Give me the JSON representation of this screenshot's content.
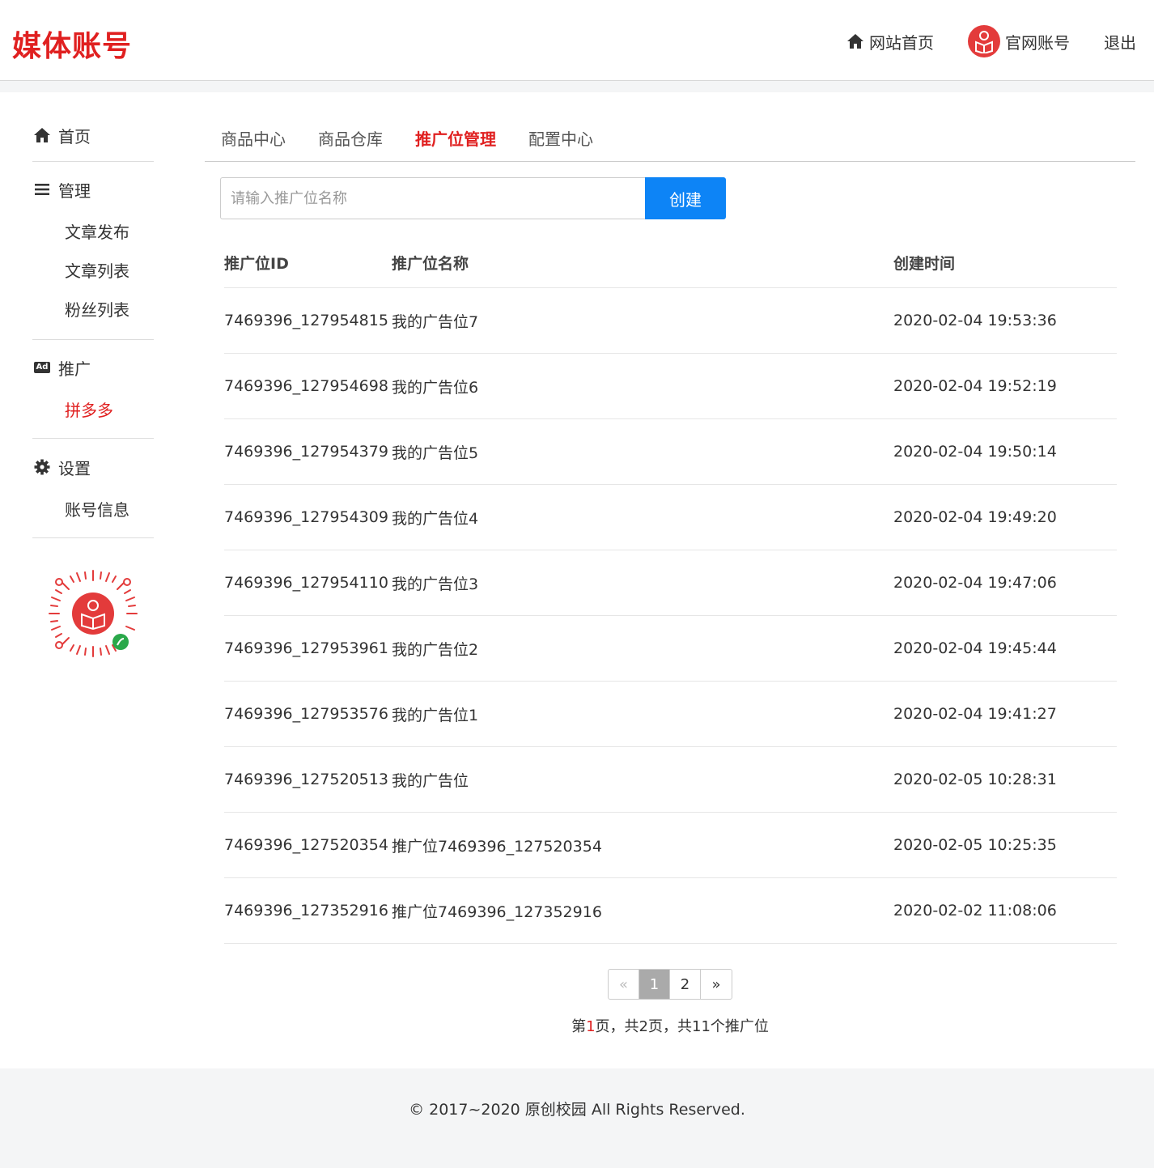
{
  "header": {
    "brand": "媒体账号",
    "nav": {
      "home_label": "网站首页",
      "account_label": "官网账号",
      "logout_label": "退出"
    }
  },
  "sidebar": {
    "home": "首页",
    "manage": {
      "title": "管理",
      "items": [
        "文章发布",
        "文章列表",
        "粉丝列表"
      ]
    },
    "promote": {
      "title": "推广",
      "badge": "Ad",
      "items": [
        "拼多多"
      ]
    },
    "settings": {
      "title": "设置",
      "items": [
        "账号信息"
      ]
    }
  },
  "tabs": [
    "商品中心",
    "商品仓库",
    "推广位管理",
    "配置中心"
  ],
  "active_tab": 2,
  "search": {
    "placeholder": "请输入推广位名称",
    "value": "",
    "button_label": "创建"
  },
  "table": {
    "headers": [
      "推广位ID",
      "推广位名称",
      "创建时间"
    ],
    "rows": [
      [
        "7469396_127954815",
        "我的广告位7",
        "2020-02-04 19:53:36"
      ],
      [
        "7469396_127954698",
        "我的广告位6",
        "2020-02-04 19:52:19"
      ],
      [
        "7469396_127954379",
        "我的广告位5",
        "2020-02-04 19:50:14"
      ],
      [
        "7469396_127954309",
        "我的广告位4",
        "2020-02-04 19:49:20"
      ],
      [
        "7469396_127954110",
        "我的广告位3",
        "2020-02-04 19:47:06"
      ],
      [
        "7469396_127953961",
        "我的广告位2",
        "2020-02-04 19:45:44"
      ],
      [
        "7469396_127953576",
        "我的广告位1",
        "2020-02-04 19:41:27"
      ],
      [
        "7469396_127520513",
        "我的广告位",
        "2020-02-05 10:28:31"
      ],
      [
        "7469396_127520354",
        "推广位7469396_127520354",
        "2020-02-05 10:25:35"
      ],
      [
        "7469396_127352916",
        "推广位7469396_127352916",
        "2020-02-02 11:08:06"
      ]
    ]
  },
  "pagination": {
    "prev": "«",
    "pages": [
      "1",
      "2"
    ],
    "current": "1",
    "next": "»",
    "info_prefix": "第",
    "info_current": "1",
    "info_suffix": "页，共2页，共11个推广位"
  },
  "footer": {
    "copyright": "© 2017~2020 原创校园 All Rights Reserved."
  },
  "colors": {
    "brand_red": "#e02020",
    "button_blue": "#0d84f6"
  }
}
